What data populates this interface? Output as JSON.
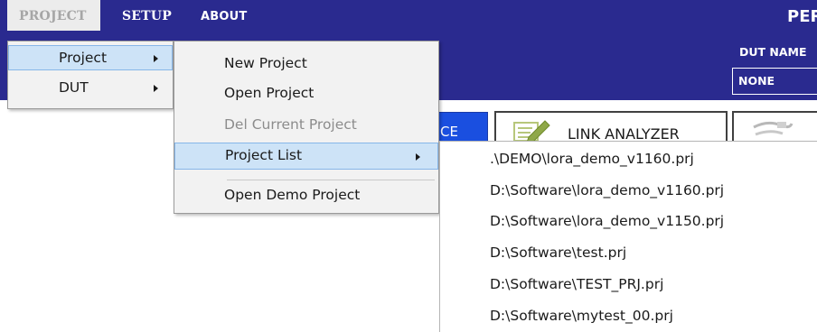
{
  "menubar": {
    "project": "PROJECT",
    "setup": "SETUP",
    "about": "ABOUT",
    "app_title_fragment": "PER"
  },
  "header": {
    "dut_name_label": "DUT NAME",
    "dut_name_value": "NONE"
  },
  "toolbar": {
    "blue_button_fragment": "CE",
    "link_analyzer": "LINK ANALYZER"
  },
  "project_menu": {
    "items": [
      {
        "label": "Project",
        "highlighted": true,
        "has_submenu": true
      },
      {
        "label": "DUT",
        "highlighted": false,
        "has_submenu": true
      }
    ]
  },
  "project_submenu": {
    "items": [
      {
        "label": "New Project",
        "enabled": true
      },
      {
        "label": "Open Project",
        "enabled": true
      },
      {
        "label": "Del Current Project",
        "enabled": false
      },
      {
        "label": "Project List",
        "enabled": true,
        "highlighted": true,
        "has_submenu": true
      },
      {
        "label": "Open Demo Project",
        "enabled": true
      }
    ]
  },
  "project_list": {
    "items": [
      ".\\DEMO\\lora_demo_v1160.prj",
      "D:\\Software\\lora_demo_v1160.prj",
      "D:\\Software\\lora_demo_v1150.prj",
      "D:\\Software\\test.prj",
      "D:\\Software\\TEST_PRJ.prj",
      "D:\\Software\\mytest_00.prj"
    ]
  },
  "colors": {
    "menubar_bg": "#2a2a8f",
    "highlight_bg": "#cde3f7",
    "highlight_border": "#86b6e8",
    "accent_button": "#1a4fe0"
  },
  "icons": [
    "edit-icon",
    "cable-icon",
    "chevron-right-icon"
  ]
}
